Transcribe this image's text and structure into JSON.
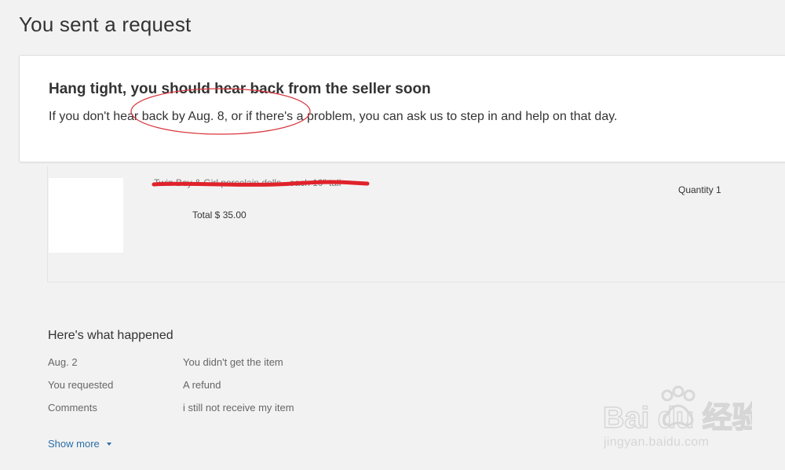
{
  "page": {
    "title": "You sent a request"
  },
  "notice": {
    "heading": "Hang tight, you should hear back from the seller soon",
    "body": "If you don't hear back by Aug. 8, or if there's a problem, you can ask us to step in and help on that day."
  },
  "item": {
    "title": "Twin Boy & Girl porcelain dolls - each 10\" tall",
    "title_redacted": true,
    "quantity": "Quantity 1",
    "total": "Total $ 35.00"
  },
  "history": {
    "heading": "Here's what happened",
    "rows": [
      {
        "label": "Aug. 2",
        "value": "You didn't get the item"
      },
      {
        "label": "You requested",
        "value": "A refund"
      },
      {
        "label": "Comments",
        "value": "i still not receive my item"
      }
    ],
    "show_more_label": "Show more"
  },
  "watermark": {
    "brand": "Bai du 经验",
    "url": "jingyan.baidu.com"
  },
  "colors": {
    "annotation_red": "#d9363e",
    "link_blue": "#2a6ea8",
    "background": "#f2f2f2"
  }
}
